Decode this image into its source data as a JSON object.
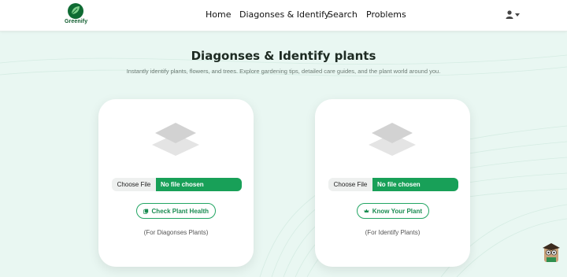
{
  "brand": {
    "name": "Greenify"
  },
  "nav": {
    "items": [
      {
        "label": "Home"
      },
      {
        "label": "Diagonses & Identify"
      },
      {
        "label": "Search"
      },
      {
        "label": "Problems"
      }
    ],
    "user_icon": "user-icon",
    "user_dropdown_icon": "caret-down-icon"
  },
  "hero": {
    "title": "Diagonses & Identify plants",
    "subtitle": "Instantly identify plants, flowers, and trees. Explore gardening tips, detailed care guides, and the plant world around you."
  },
  "cards": [
    {
      "choose_label": "Choose File",
      "file_status": "No file chosen",
      "button_label": "Check Plant Health",
      "button_icon": "plant-health-icon",
      "caption": "(For Diagonses Plants)"
    },
    {
      "choose_label": "Choose File",
      "file_status": "No file chosen",
      "button_label": "Know Your Plant",
      "button_icon": "crown-icon",
      "caption": "(For Identify Plants)"
    }
  ],
  "colors": {
    "accent": "#18a058",
    "background": "#e9f7f2",
    "brand_dark": "#0f5c2e"
  }
}
